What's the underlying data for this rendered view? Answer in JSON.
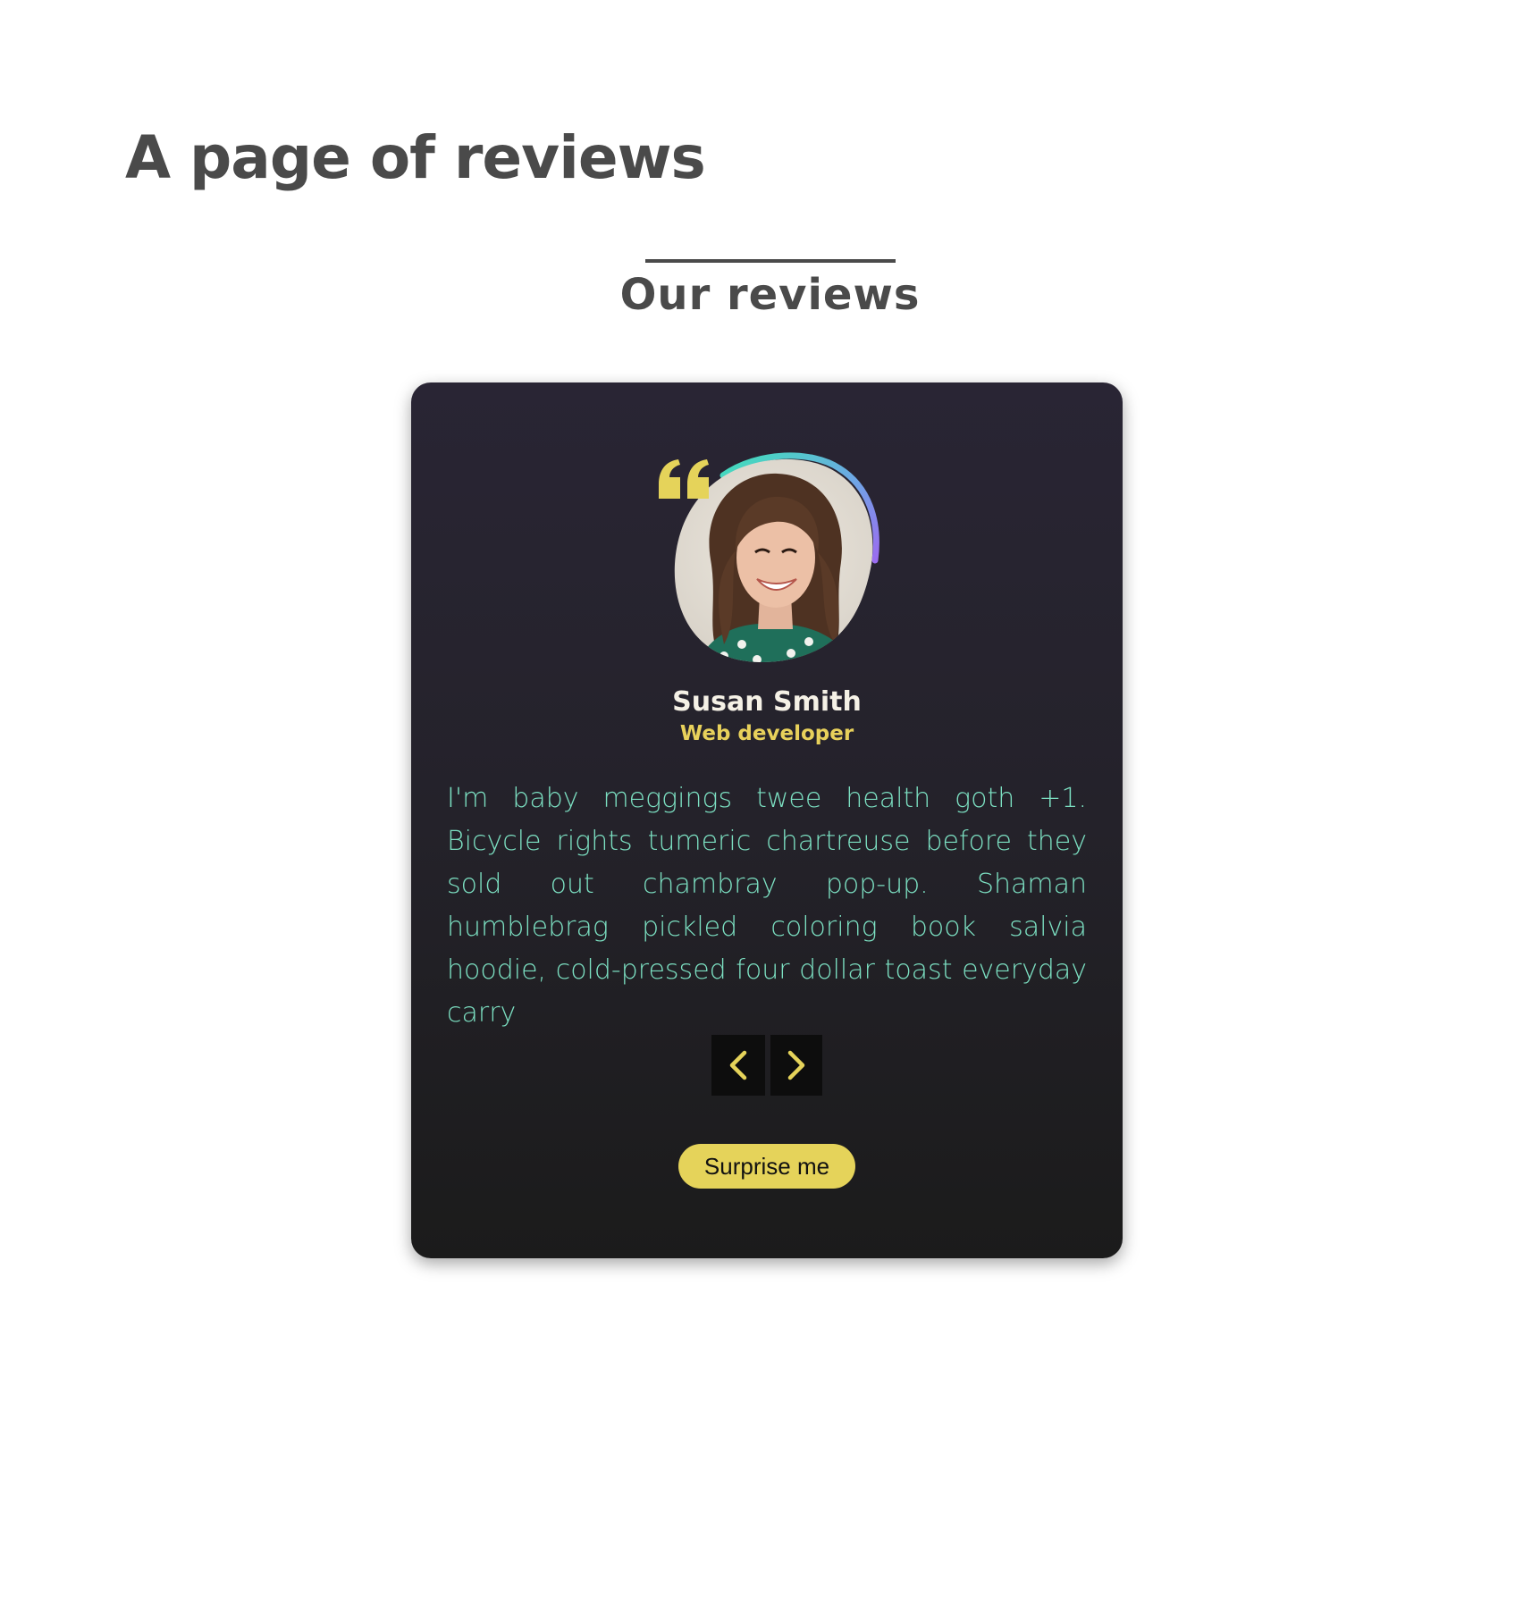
{
  "page": {
    "title": "A page of reviews"
  },
  "section": {
    "title": "Our reviews"
  },
  "review": {
    "name": "Susan Smith",
    "role": "Web developer",
    "text": "I'm baby meggings twee health goth +1. Bicycle rights tumeric chartreuse before they sold out chambray pop-up. Shaman humblebrag pickled coloring book salvia hoodie, cold-pressed four dollar toast everyday carry"
  },
  "controls": {
    "prev_icon": "chevron-left-icon",
    "next_icon": "chevron-right-icon",
    "surprise_label": "Surprise me"
  },
  "colors": {
    "accent": "#e5d35a",
    "text_teal": "#7ce0c2",
    "heading_gray": "#4a4a4a",
    "card_top": "#292534",
    "card_bottom": "#1b1b1b"
  }
}
